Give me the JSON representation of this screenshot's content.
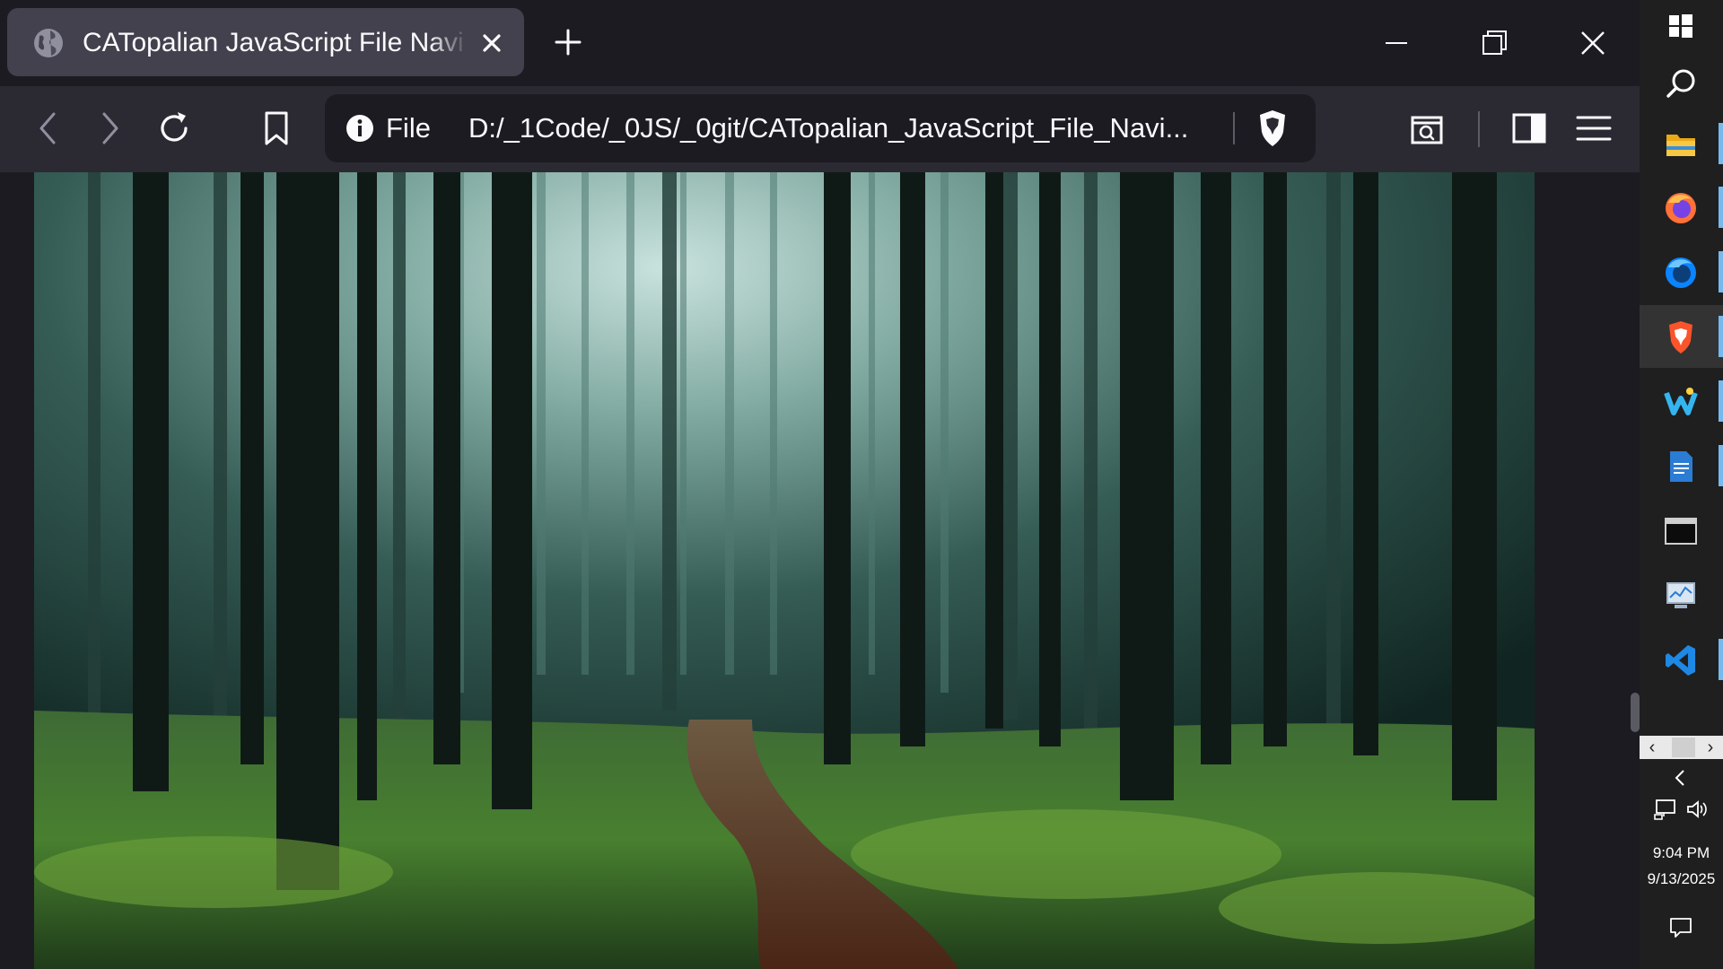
{
  "tab": {
    "title": "CATopalian JavaScript File Navigator",
    "favicon": "globe-icon"
  },
  "urlbar": {
    "scheme_label": "File",
    "url": "D:/_1Code/_0JS/_0git/CATopalian_JavaScript_File_Navi..."
  },
  "colors": {
    "tab_bg": "#42414d",
    "toolbar_bg": "#2b2a33",
    "urlbar_bg": "#1c1b22",
    "taskbar_bg": "#1f1f1f",
    "accent_indicator": "#76b9ed"
  },
  "taskbar": {
    "apps": [
      "start-icon",
      "search-icon",
      "file-explorer-icon",
      "firefox-icon",
      "firefox-developer-icon",
      "brave-icon",
      "weather-app-icon",
      "document-app-icon",
      "terminal-icon",
      "system-monitor-icon",
      "vscode-icon"
    ],
    "active_app": "brave-icon",
    "time": "9:04 PM",
    "date": "9/13/2025"
  }
}
